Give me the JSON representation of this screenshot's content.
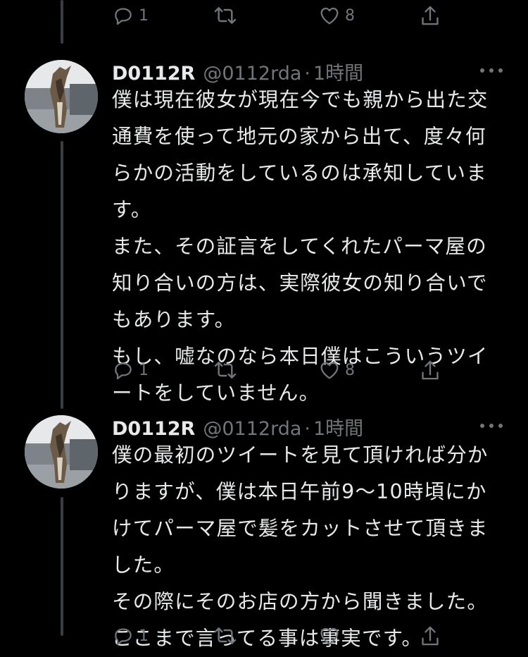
{
  "tweets": [
    {
      "actions": {
        "reply_count": "1",
        "retweet_count": "",
        "like_count": "8"
      }
    },
    {
      "name": "D0112R",
      "handle": "@0112rda",
      "dot": "·",
      "time": "1時間",
      "lines": [
        "僕は現在彼女が現在今でも親から出た交",
        "通費を使って地元の家から出て、度々何",
        "らかの活動をしているのは承知していま",
        "す。",
        "また、その証言をしてくれたパーマ屋の",
        "知り合いの方は、実際彼女の知り合いで",
        "もあります。",
        "もし、嘘なのなら本日僕はこういうツイ",
        "ートをしていません。"
      ],
      "actions": {
        "reply_count": "1",
        "retweet_count": "",
        "like_count": "8"
      }
    },
    {
      "name": "D0112R",
      "handle": "@0112rda",
      "dot": "·",
      "time": "1時間",
      "lines": [
        "僕の最初のツイートを見て頂ければ分か",
        "りますが、僕は本日午前9〜10時頃にか",
        "けてパーマ屋で髪をカットさせて頂きま",
        "した。",
        "その際にそのお店の方から聞きました。",
        "ここまで言ってる事は事実です。"
      ],
      "actions": {
        "reply_count": "1",
        "retweet_count": "",
        "like_count": ""
      }
    }
  ],
  "icons": {
    "reply": "reply-icon",
    "retweet": "retweet-icon",
    "like": "heart-icon",
    "share": "share-icon",
    "more": "more-icon"
  },
  "colors": {
    "background": "#000000",
    "text": "#e7e9ea",
    "secondary": "#71767b",
    "thread_line": "#3a3d41"
  }
}
